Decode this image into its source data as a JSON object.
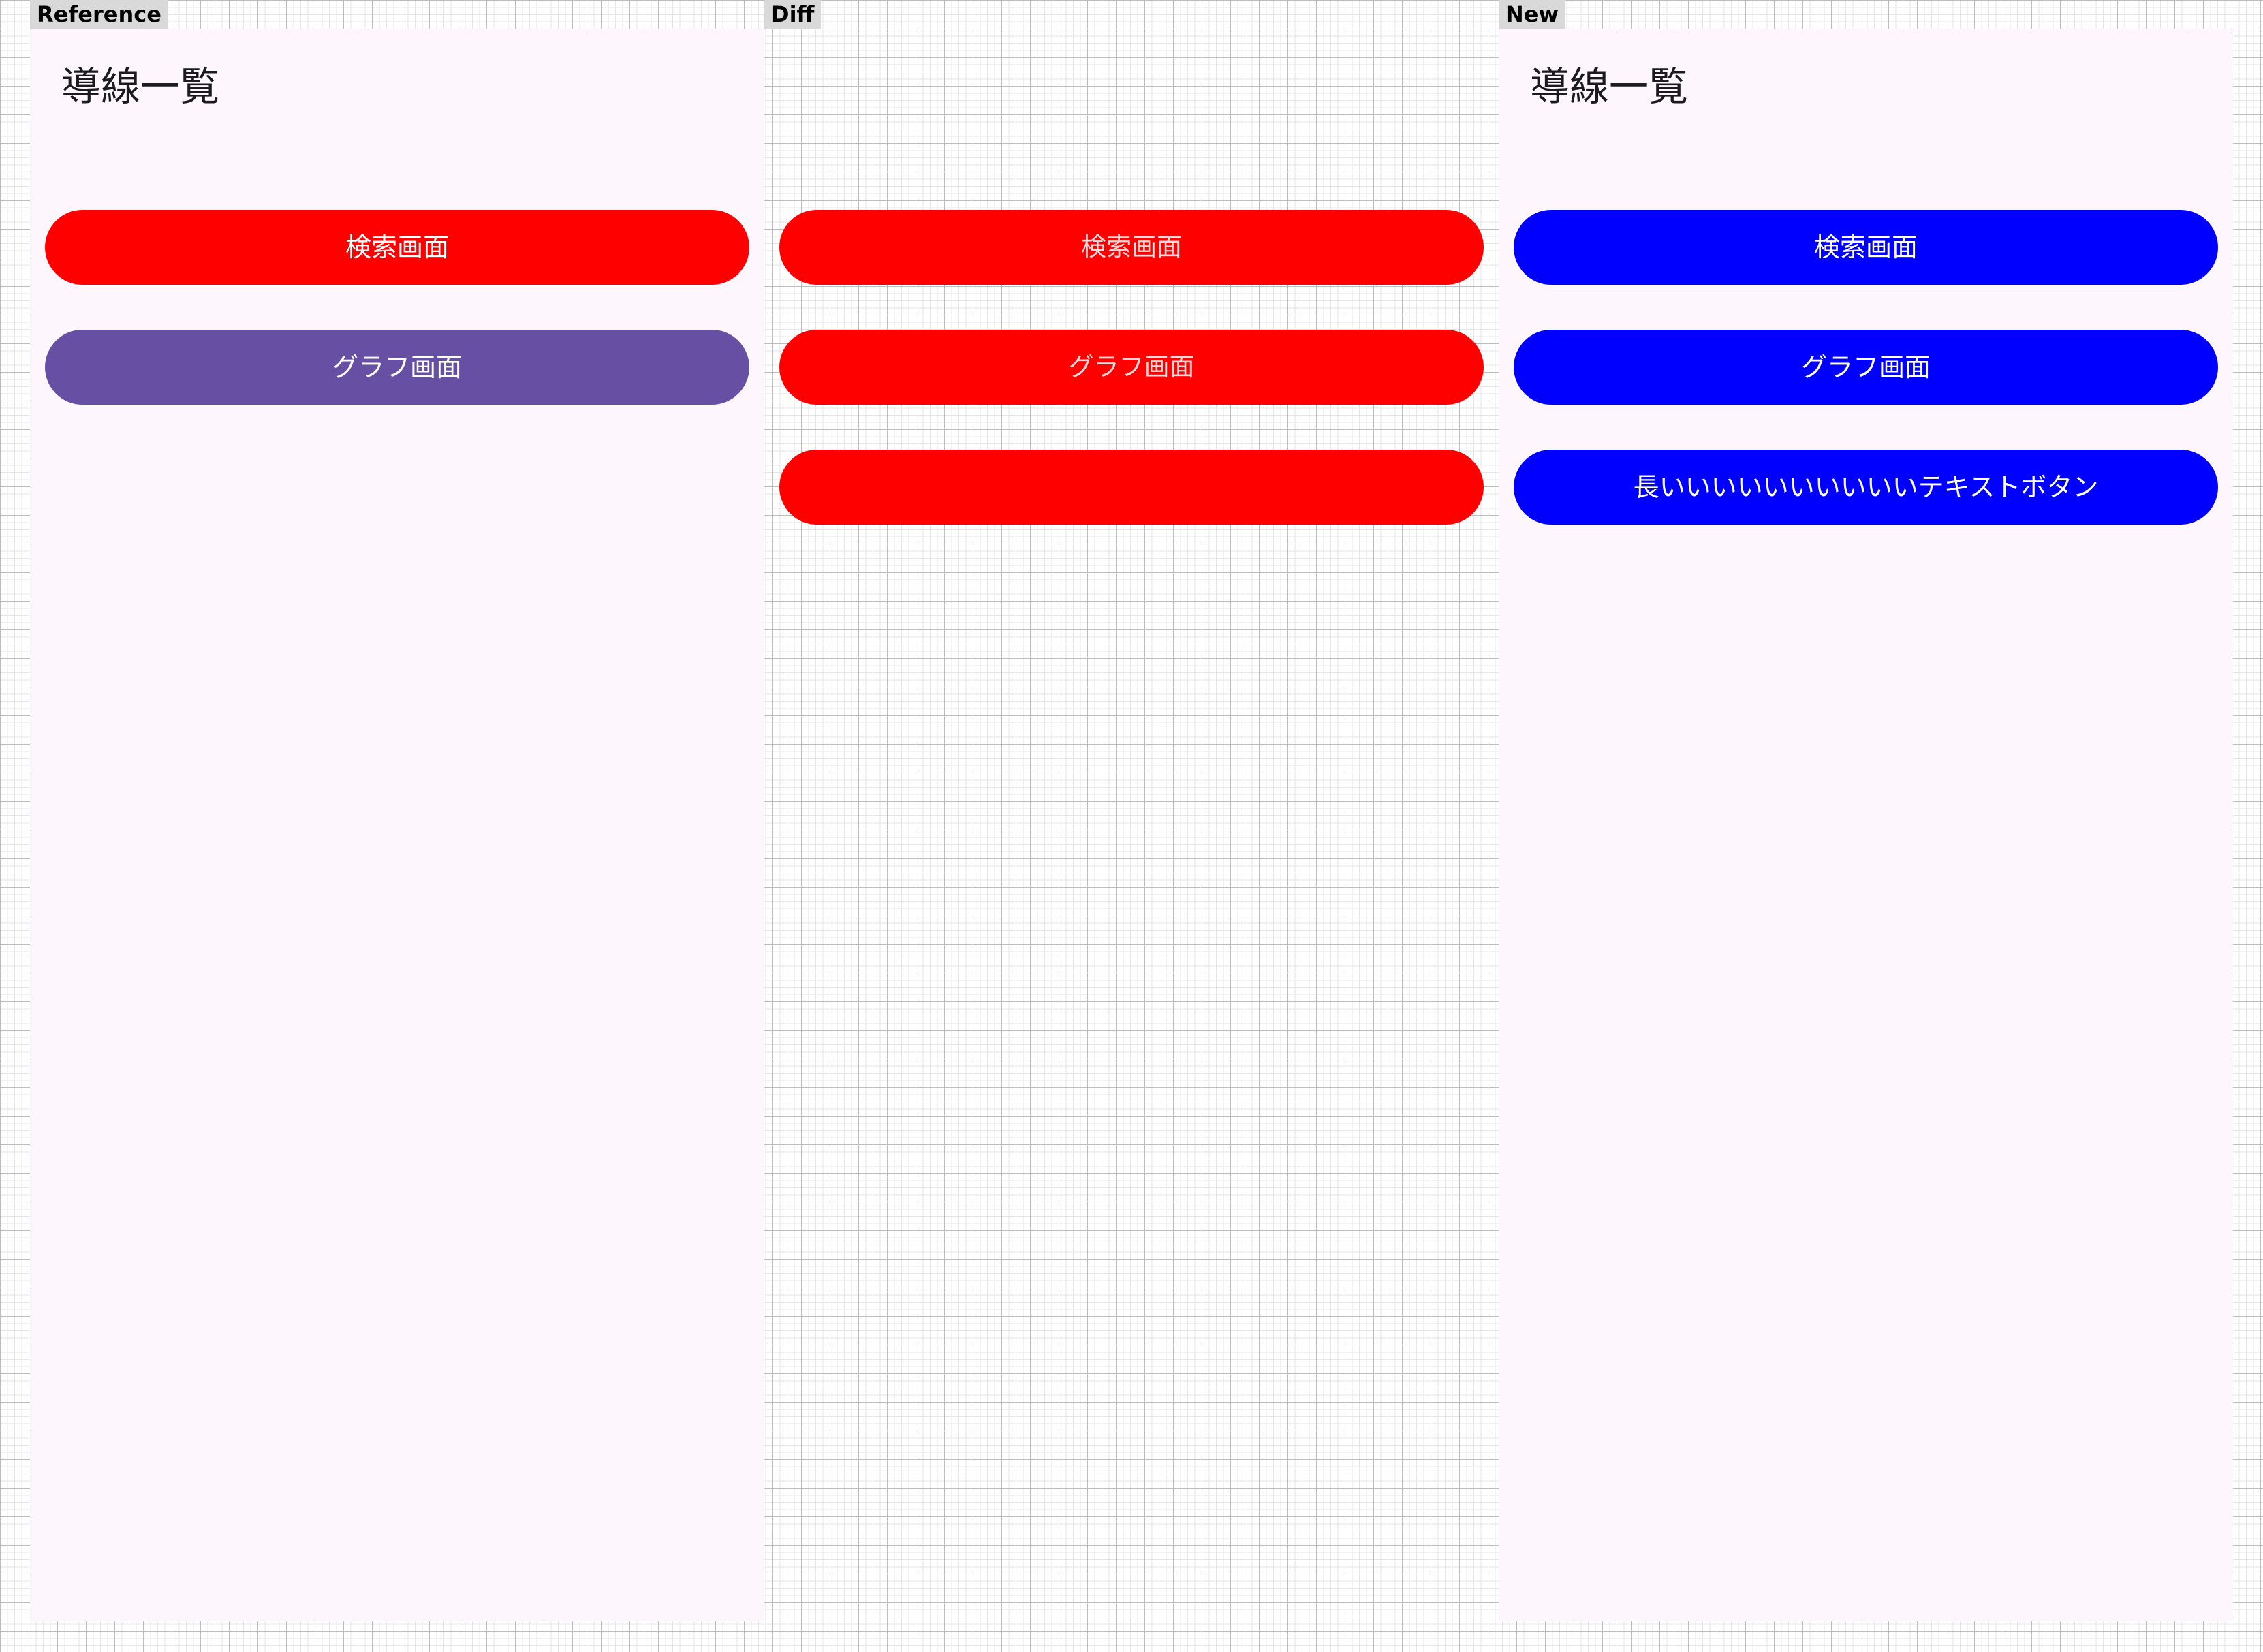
{
  "panels": {
    "reference": {
      "label": "Reference"
    },
    "diff": {
      "label": "Diff"
    },
    "new": {
      "label": "New"
    }
  },
  "screen": {
    "title": "導線一覧",
    "background": "#fdf7fd"
  },
  "reference_buttons": [
    {
      "label": "検索画面",
      "color": "#ff0000"
    },
    {
      "label": "グラフ画面",
      "color": "#6750a4"
    }
  ],
  "diff_buttons": [
    {
      "label": "検索画面",
      "color": "#ff0000"
    },
    {
      "label": "グラフ画面",
      "color": "#ff0000"
    },
    {
      "label": "",
      "color": "#ff0000"
    }
  ],
  "new_buttons": [
    {
      "label": "検索画面",
      "color": "#0000ff"
    },
    {
      "label": "グラフ画面",
      "color": "#0000ff"
    },
    {
      "label": "長いいいいいいいいいいテキストボタン",
      "color": "#0000ff"
    }
  ]
}
